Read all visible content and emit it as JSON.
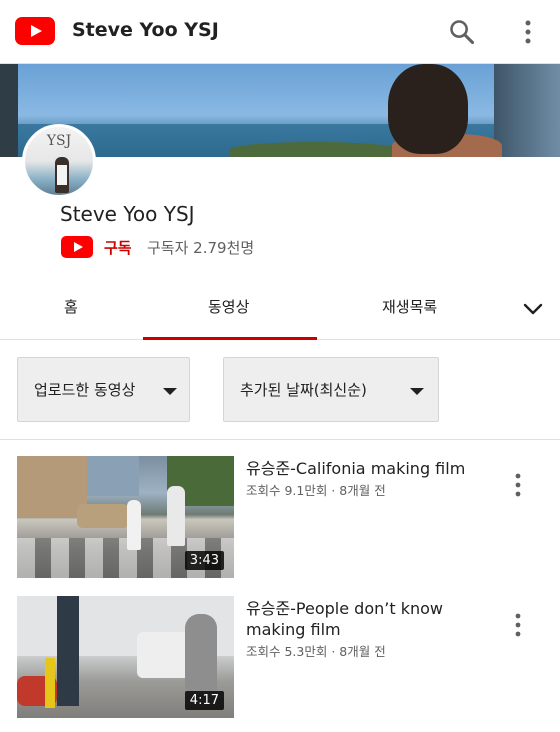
{
  "appbar": {
    "title": "Steve Yoo YSJ",
    "logo_icon": "youtube-logo-icon",
    "search_icon": "search-icon",
    "more_icon": "more-vert-icon",
    "accent_color": "#ff0000"
  },
  "channel": {
    "avatar_text": "YSJ",
    "name": "Steve Yoo YSJ",
    "subscribe_label": "구독",
    "subscriber_text": "구독자 2.79천명",
    "subscribe_color": "#cc0000"
  },
  "tabs": [
    {
      "label": "홈",
      "selected": false
    },
    {
      "label": "동영상",
      "selected": true
    },
    {
      "label": "재생목록",
      "selected": false
    }
  ],
  "tabs_more_icon": "chevron-down-icon",
  "filters": {
    "upload_filter": "업로드한 동영상",
    "sort_filter": "추가된 날짜(최신순)"
  },
  "videos": [
    {
      "title": "유승준-Califonia making film",
      "meta": "조회수 9.1만회 · 8개월 전",
      "duration": "3:43"
    },
    {
      "title": "유승준-People don’t know making film",
      "meta": "조회수 5.3만회 · 8개월 전",
      "duration": "4:17"
    }
  ]
}
